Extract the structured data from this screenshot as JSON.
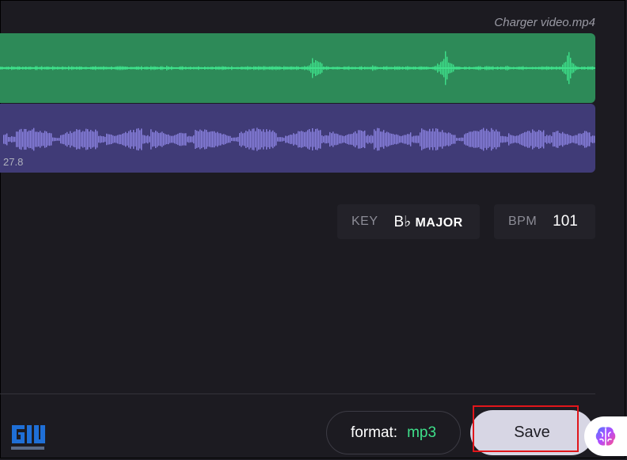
{
  "media": {
    "file_name": "Charger video.mp4",
    "time_marker": "27.8"
  },
  "analysis": {
    "key_label": "KEY",
    "key_note": "B♭",
    "key_mode": "MAJOR",
    "bpm_label": "BPM",
    "bpm_value": "101"
  },
  "export": {
    "format_label": "format:",
    "format_value": "mp3",
    "save_label": "Save"
  },
  "colors": {
    "background": "#1c1b21",
    "vocals_track": "#2d8a58",
    "vocals_wave": "#3ee08a",
    "music_track": "#403b77",
    "music_wave": "#8a82e0",
    "format_accent": "#3ee08a",
    "highlight": "#e0161b",
    "save_button": "#d7d6e4"
  },
  "icons": {
    "brain": "brain-icon",
    "logo": "gadgets-to-use-logo"
  }
}
